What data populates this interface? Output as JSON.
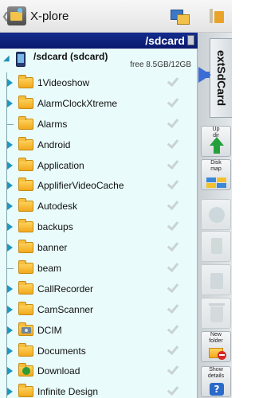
{
  "app": {
    "title": "X-plore"
  },
  "toolbar": {
    "pane_icon": "dual-pane-icon",
    "menu_icon": "menu-icon"
  },
  "panel": {
    "path_title": "/sdcard",
    "root": {
      "name": "/sdcard (sdcard)",
      "free_text": "free 8.5GB/12GB"
    },
    "folders": [
      {
        "name": "1Videoshow",
        "expandable": true
      },
      {
        "name": "AlarmClockXtreme",
        "expandable": true
      },
      {
        "name": "Alarms",
        "expandable": false
      },
      {
        "name": "Android",
        "expandable": true
      },
      {
        "name": "Application",
        "expandable": true
      },
      {
        "name": "ApplifierVideoCache",
        "expandable": true
      },
      {
        "name": "Autodesk",
        "expandable": true
      },
      {
        "name": "backups",
        "expandable": true
      },
      {
        "name": "banner",
        "expandable": true
      },
      {
        "name": "beam",
        "expandable": false
      },
      {
        "name": "CallRecorder",
        "expandable": true
      },
      {
        "name": "CamScanner",
        "expandable": true
      },
      {
        "name": "DCIM",
        "expandable": true,
        "badge": "camera"
      },
      {
        "name": "Documents",
        "expandable": true
      },
      {
        "name": "Download",
        "expandable": true,
        "badge": "download"
      },
      {
        "name": "Infinite Design",
        "expandable": true
      }
    ]
  },
  "side_tab": {
    "label": "extSdCard"
  },
  "tools": [
    {
      "label": "Up dir",
      "icon": "up-arrow-icon",
      "enabled": true
    },
    {
      "label": "Disk map",
      "icon": "disk-map-icon",
      "enabled": true
    },
    {
      "label": "",
      "icon": "copy-icon",
      "enabled": false
    },
    {
      "label": "",
      "icon": "move-icon",
      "enabled": false
    },
    {
      "label": "",
      "icon": "rename-icon",
      "enabled": false
    },
    {
      "label": "",
      "icon": "trash-icon",
      "enabled": false
    },
    {
      "label": "New folder",
      "icon": "new-folder-icon",
      "enabled": true
    },
    {
      "label": "Show details",
      "icon": "help-icon",
      "enabled": true
    }
  ]
}
